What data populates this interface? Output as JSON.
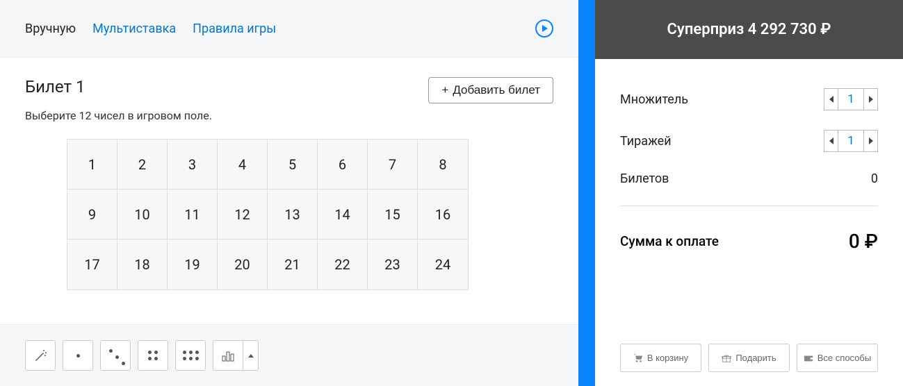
{
  "tabs": {
    "manual": "Вручную",
    "multi": "Мультиставка",
    "rules": "Правила игры"
  },
  "ticket": {
    "title": "Билет 1",
    "subtitle": "Выберите 12 чисел в игровом поле.",
    "add_button": "Добавить билет",
    "numbers": [
      "1",
      "2",
      "3",
      "4",
      "5",
      "6",
      "7",
      "8",
      "9",
      "10",
      "11",
      "12",
      "13",
      "14",
      "15",
      "16",
      "17",
      "18",
      "19",
      "20",
      "21",
      "22",
      "23",
      "24"
    ]
  },
  "prize": {
    "label": "Суперприз 4 292 730 ₽"
  },
  "summary": {
    "multiplier_label": "Множитель",
    "multiplier_value": "1",
    "draws_label": "Тиражей",
    "draws_value": "1",
    "tickets_label": "Билетов",
    "tickets_value": "0",
    "total_label": "Сумма к оплате",
    "total_amount": "0 ₽"
  },
  "actions": {
    "cart": "В корзину",
    "gift": "Подарить",
    "all": "Все способы"
  }
}
